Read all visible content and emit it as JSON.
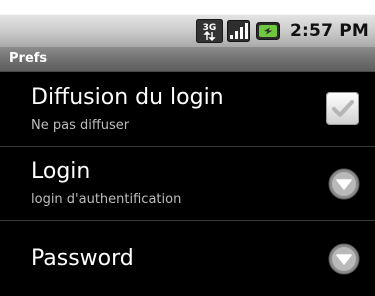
{
  "status_bar": {
    "network_type": "3G",
    "network_icon": "3g-data-icon",
    "signal_icon": "signal-strength-icon",
    "battery_icon": "battery-charging-icon",
    "time": "2:57 PM",
    "battery_color": "#6fc83f"
  },
  "title_bar": {
    "title": "Prefs"
  },
  "preferences": [
    {
      "title": "Diffusion du login",
      "summary": "Ne pas diffuser",
      "widget": "checkbox",
      "checked": true
    },
    {
      "title": "Login",
      "summary": "login d'authentification",
      "widget": "chevron-down-icon"
    },
    {
      "title": "Password",
      "summary": "",
      "widget": "chevron-down-icon"
    }
  ],
  "colors": {
    "background": "#000000",
    "title_text": "#ffffff",
    "summary_text": "#bdbdbd"
  }
}
